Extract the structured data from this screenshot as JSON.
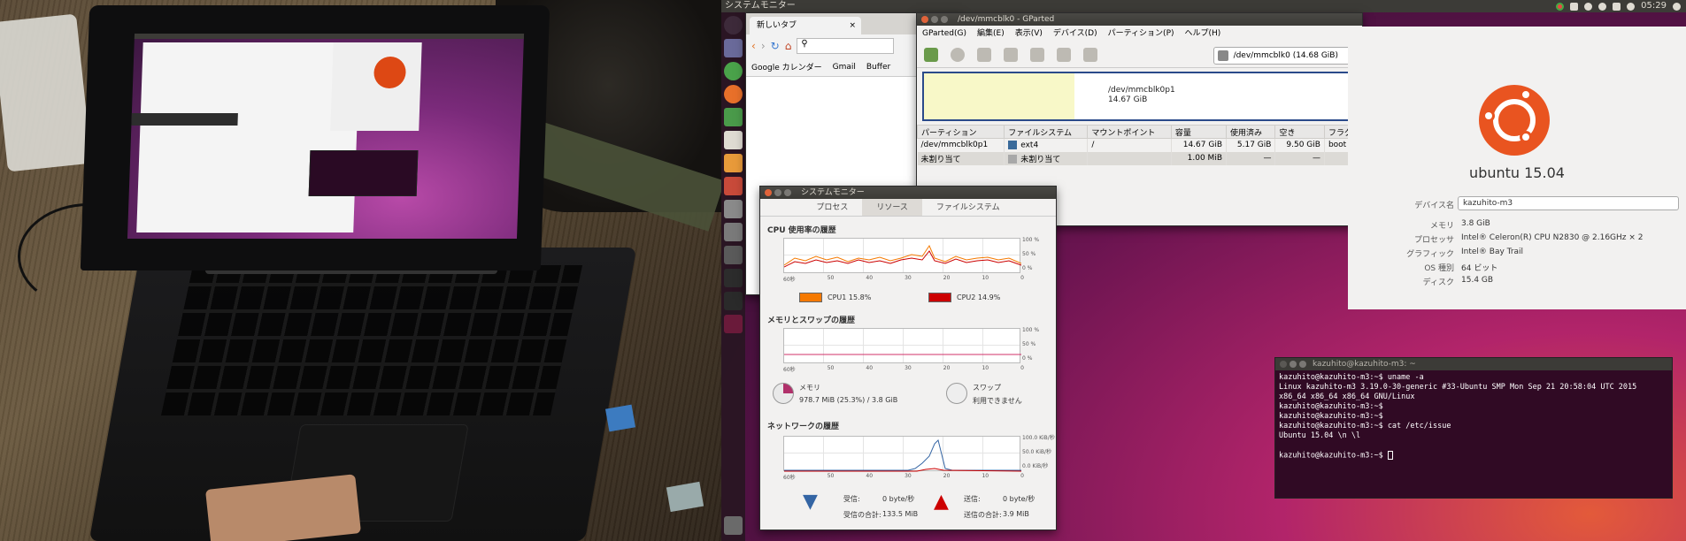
{
  "topbar": {
    "title": "システムモニター",
    "clock": "05:29"
  },
  "chrome": {
    "tab_label": "新しいタブ",
    "bookmarks": [
      "Google カレンダー",
      "Gmail",
      "Buffer"
    ]
  },
  "gparted": {
    "title": "/dev/mmcblk0 - GParted",
    "menu": [
      "GParted(G)",
      "編集(E)",
      "表示(V)",
      "デバイス(D)",
      "パーティション(P)",
      "ヘルプ(H)"
    ],
    "device_selector": "/dev/mmcblk0   (14.68 GiB)",
    "map_label_line1": "/dev/mmcblk0p1",
    "map_label_line2": "14.67 GiB",
    "columns": [
      "パーティション",
      "ファイルシステム",
      "マウントポイント",
      "容量",
      "使用済み",
      "空き",
      "フラグ"
    ],
    "rows": [
      {
        "partition": "/dev/mmcblk0p1",
        "fs": "ext4",
        "mount": "/",
        "size": "14.67 GiB",
        "used": "5.17 GiB",
        "free": "9.50 GiB",
        "flags": "boot"
      },
      {
        "partition": "未割り当て",
        "fs": "未割り当て",
        "mount": "",
        "size": "1.00 MiB",
        "used": "—",
        "free": "—",
        "flags": ""
      }
    ]
  },
  "sysmon": {
    "title": "システムモニター",
    "tabs": [
      "プロセス",
      "リソース",
      "ファイルシステム"
    ],
    "cpu_header": "CPU 使用率の履歴",
    "mem_header": "メモリとスワップの履歴",
    "net_header": "ネットワークの履歴",
    "pct_ticks": [
      "100 %",
      "50 %",
      "0 %"
    ],
    "net_ticks": [
      "100.0 KiB/秒",
      "50.0 KiB/秒",
      "0.0 KiB/秒"
    ],
    "time_ticks": [
      "60秒",
      "50",
      "40",
      "30",
      "20",
      "10",
      "0"
    ],
    "cpu1": "CPU1  15.8%",
    "cpu2": "CPU2  14.9%",
    "cpu1_color": "#f57900",
    "cpu2_color": "#cc0000",
    "mem_label": "メモリ",
    "mem_value": "978.7 MiB (25.3%) / 3.8 GiB",
    "swap_label": "スワップ",
    "swap_value": "利用できません",
    "recv_label": "受信:",
    "recv_value": "0 byte/秒",
    "recv_total_label": "受信の合計:",
    "recv_total_value": "133.5 MiB",
    "send_label": "送信:",
    "send_value": "0 byte/秒",
    "send_total_label": "送信の合計:",
    "send_total_value": "3.9 MiB"
  },
  "about": {
    "os": "ubuntu 15.04",
    "fields": [
      {
        "key": "デバイス名",
        "value": "kazuhito-m3"
      },
      {
        "key": "メモリ",
        "value": "3.8 GiB"
      },
      {
        "key": "プロセッサ",
        "value": "Intel® Celeron(R) CPU N2830 @ 2.16GHz × 2"
      },
      {
        "key": "グラフィック",
        "value": "Intel® Bay Trail"
      },
      {
        "key": "OS 種別",
        "value": "64 ビット"
      },
      {
        "key": "ディスク",
        "value": "15.4 GB"
      }
    ]
  },
  "terminal": {
    "title": "kazuhito@kazuhito-m3: ~",
    "lines": [
      "kazuhito@kazuhito-m3:~$ uname -a",
      "Linux kazuhito-m3 3.19.0-30-generic #33-Ubuntu SMP Mon Sep 21 20:58:04 UTC 2015",
      "x86_64 x86_64 x86_64 GNU/Linux",
      "kazuhito@kazuhito-m3:~$",
      "kazuhito@kazuhito-m3:~$",
      "kazuhito@kazuhito-m3:~$ cat /etc/issue",
      "Ubuntu 15.04 \\n \\l",
      "",
      "kazuhito@kazuhito-m3:~$ "
    ]
  }
}
